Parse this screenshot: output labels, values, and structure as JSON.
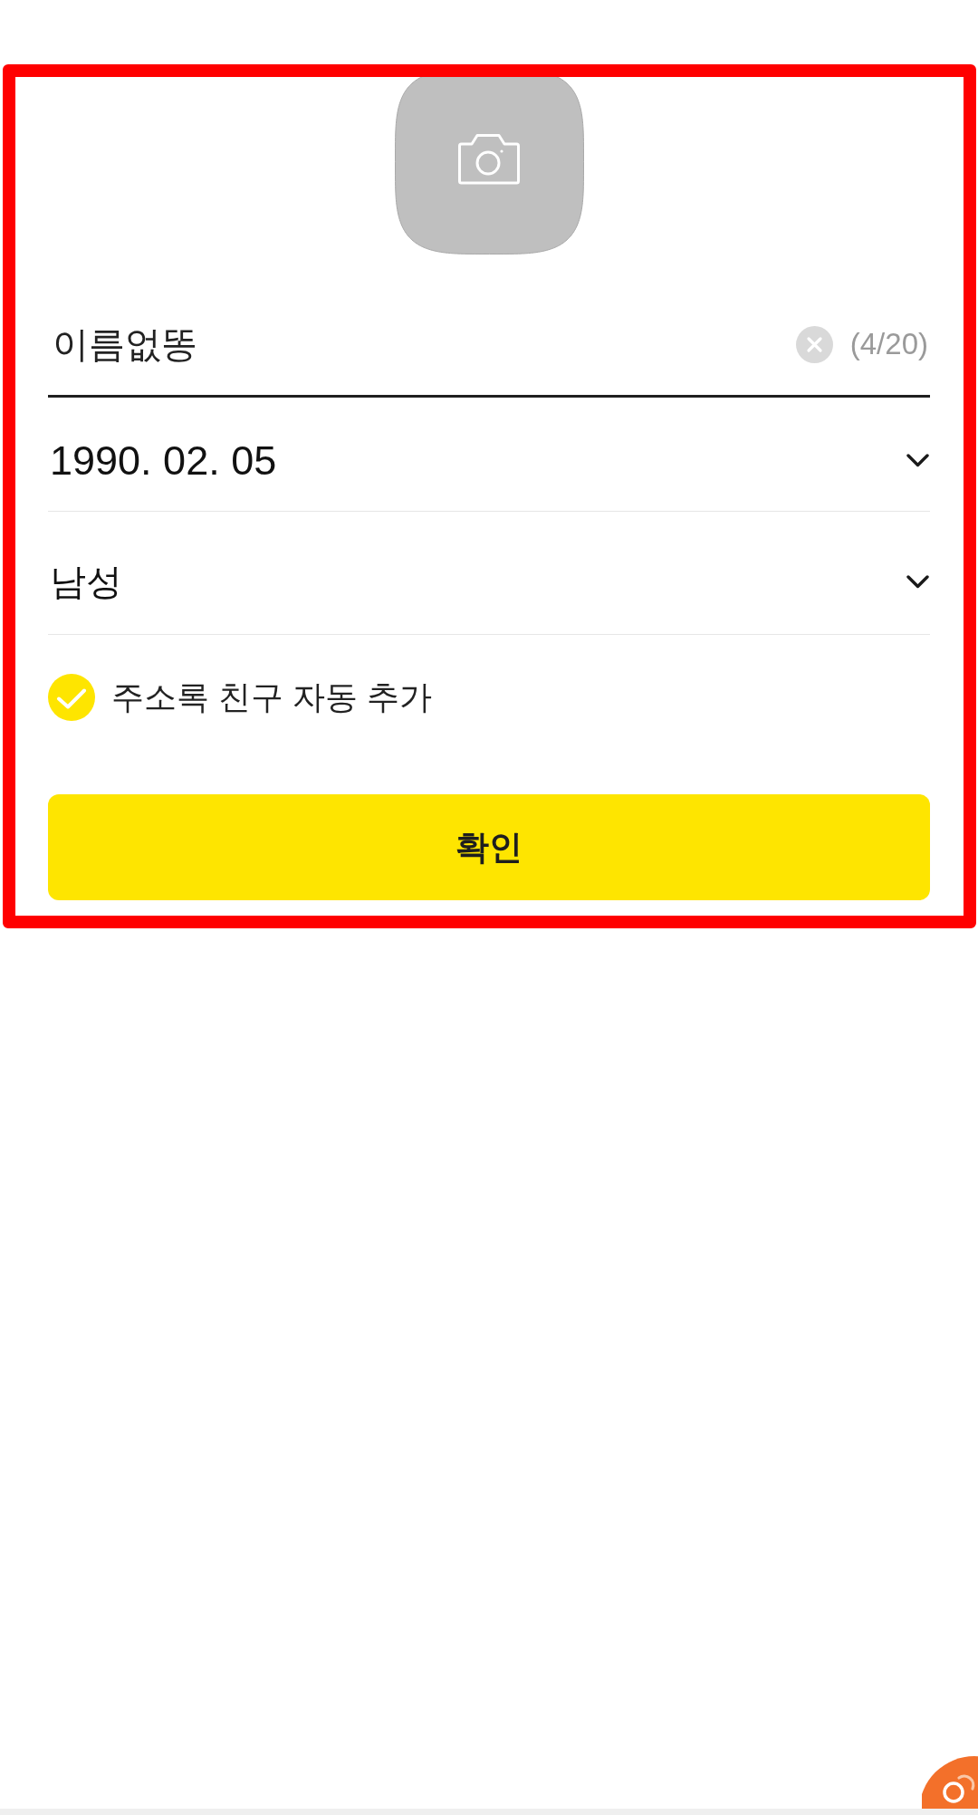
{
  "name_field": {
    "value": "이름없똥",
    "counter": "(4/20)"
  },
  "birthdate": {
    "value": "1990. 02. 05"
  },
  "gender": {
    "value": "남성"
  },
  "auto_add_contacts": {
    "label": "주소록 친구 자동 추가",
    "checked": true
  },
  "confirm_button": {
    "label": "확인"
  }
}
